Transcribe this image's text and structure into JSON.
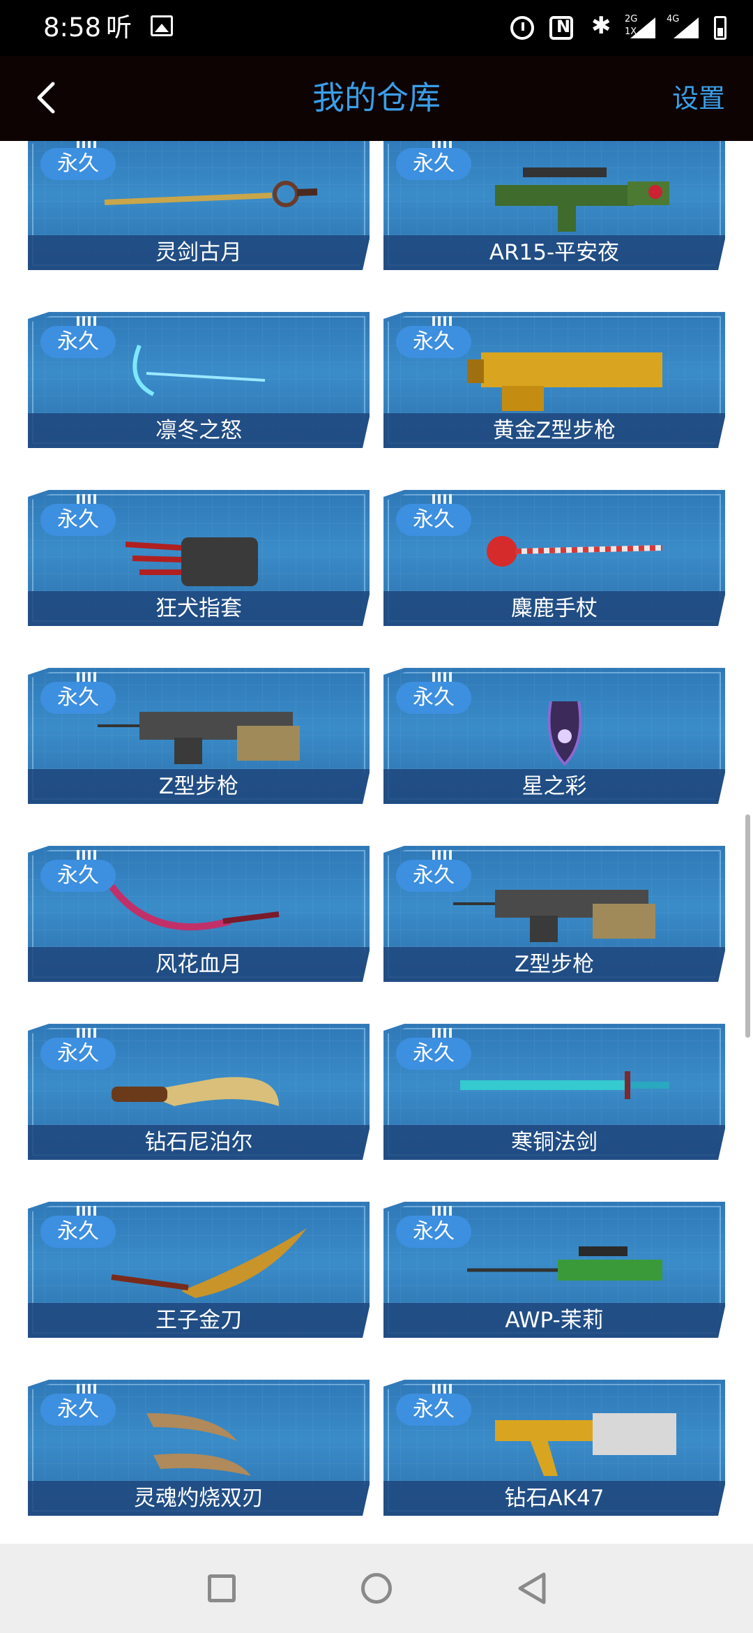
{
  "status_bar": {
    "time": "8:58",
    "app_indicator": "听",
    "net_top": "2G",
    "net_bottom": "1X",
    "net_4g": "4G"
  },
  "header": {
    "title": "我的仓库",
    "settings_label": "设置"
  },
  "items": [
    {
      "badge": "永久",
      "name": "灵剑古月"
    },
    {
      "badge": "永久",
      "name": "AR15-平安夜"
    },
    {
      "badge": "永久",
      "name": "凛冬之怒"
    },
    {
      "badge": "永久",
      "name": "黄金Z型步枪"
    },
    {
      "badge": "永久",
      "name": "狂犬指套"
    },
    {
      "badge": "永久",
      "name": "麋鹿手杖"
    },
    {
      "badge": "永久",
      "name": "Z型步枪"
    },
    {
      "badge": "永久",
      "name": "星之彩"
    },
    {
      "badge": "永久",
      "name": "风花血月"
    },
    {
      "badge": "永久",
      "name": "Z型步枪"
    },
    {
      "badge": "永久",
      "name": "钻石尼泊尔"
    },
    {
      "badge": "永久",
      "name": "寒铜法剑"
    },
    {
      "badge": "永久",
      "name": "王子金刀"
    },
    {
      "badge": "永久",
      "name": "AWP-茉莉"
    },
    {
      "badge": "永久",
      "name": "灵魂灼烧双刃"
    },
    {
      "badge": "永久",
      "name": "钻石AK47"
    }
  ],
  "colors": {
    "accent": "#3a9ee8",
    "card_blue": "#3a8cc9",
    "badge_blue": "#3d8fe0"
  }
}
